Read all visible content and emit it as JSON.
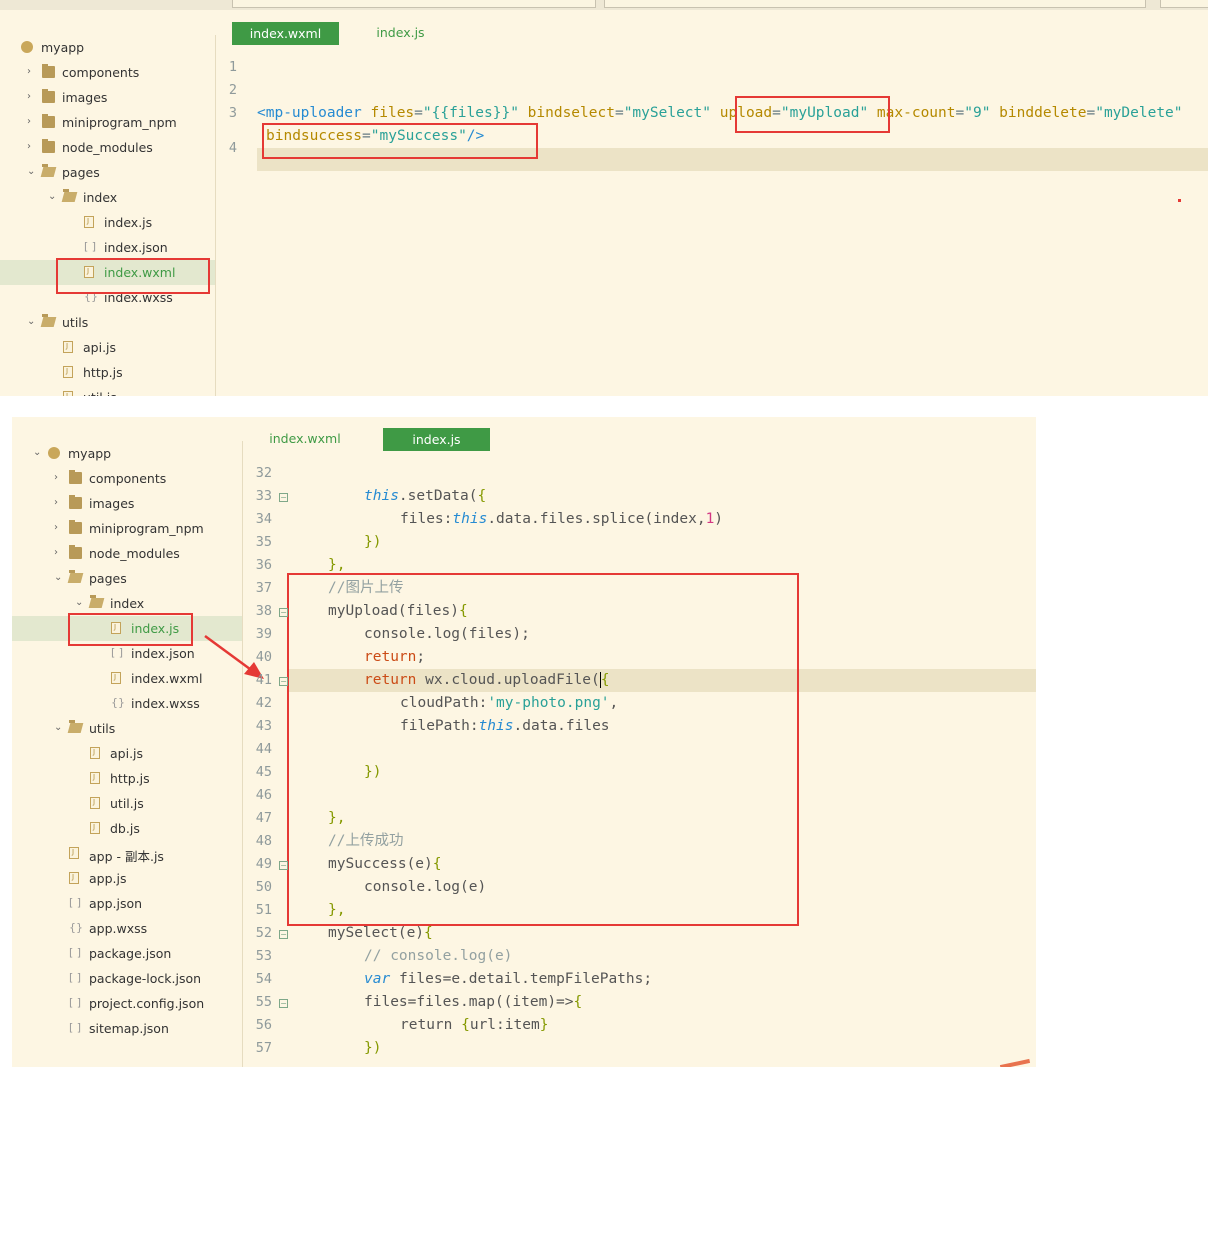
{
  "top": {
    "tree": {
      "items": [
        {
          "label": "myapp",
          "icon": "app-icon",
          "depth": 0,
          "chevron": ""
        },
        {
          "label": "components",
          "icon": "folder-icon",
          "depth": 1,
          "chevron": "›"
        },
        {
          "label": "images",
          "icon": "folder-icon",
          "depth": 1,
          "chevron": "›"
        },
        {
          "label": "miniprogram_npm",
          "icon": "folder-icon",
          "depth": 1,
          "chevron": "›"
        },
        {
          "label": "node_modules",
          "icon": "folder-icon",
          "depth": 1,
          "chevron": "›"
        },
        {
          "label": "pages",
          "icon": "folder-open-icon",
          "depth": 1,
          "chevron": "⌄"
        },
        {
          "label": "index",
          "icon": "folder-open-icon",
          "depth": 2,
          "chevron": "⌄"
        },
        {
          "label": "index.js",
          "icon": "js-file-icon",
          "depth": 3,
          "chevron": ""
        },
        {
          "label": "index.json",
          "icon": "json-file-icon",
          "depth": 3,
          "chevron": ""
        },
        {
          "label": "index.wxml",
          "icon": "wxml-file-icon",
          "depth": 3,
          "chevron": "",
          "selected": true
        },
        {
          "label": "index.wxss",
          "icon": "wxss-file-icon",
          "depth": 3,
          "chevron": ""
        },
        {
          "label": "utils",
          "icon": "folder-open-icon",
          "depth": 1,
          "chevron": "⌄"
        },
        {
          "label": "api.js",
          "icon": "js-file-icon",
          "depth": 2,
          "chevron": ""
        },
        {
          "label": "http.js",
          "icon": "js-file-icon",
          "depth": 2,
          "chevron": ""
        },
        {
          "label": "util.js",
          "icon": "js-file-icon",
          "depth": 2,
          "chevron": ""
        }
      ]
    },
    "tabs": [
      {
        "label": "index.wxml",
        "active": true
      },
      {
        "label": "index.js",
        "active": false
      }
    ],
    "line_numbers": [
      "1",
      "2",
      "3",
      "",
      "4"
    ]
  },
  "bottom": {
    "tree": {
      "items": [
        {
          "label": "myapp",
          "icon": "app-icon",
          "depth": 0,
          "chevron": "⌄"
        },
        {
          "label": "components",
          "icon": "folder-icon",
          "depth": 1,
          "chevron": "›"
        },
        {
          "label": "images",
          "icon": "folder-icon",
          "depth": 1,
          "chevron": "›"
        },
        {
          "label": "miniprogram_npm",
          "icon": "folder-icon",
          "depth": 1,
          "chevron": "›"
        },
        {
          "label": "node_modules",
          "icon": "folder-icon",
          "depth": 1,
          "chevron": "›"
        },
        {
          "label": "pages",
          "icon": "folder-open-icon",
          "depth": 1,
          "chevron": "⌄"
        },
        {
          "label": "index",
          "icon": "folder-open-icon",
          "depth": 2,
          "chevron": "⌄"
        },
        {
          "label": "index.js",
          "icon": "js-file-icon",
          "depth": 3,
          "chevron": "",
          "selected": true
        },
        {
          "label": "index.json",
          "icon": "json-file-icon",
          "depth": 3,
          "chevron": ""
        },
        {
          "label": "index.wxml",
          "icon": "wxml-file-icon",
          "depth": 3,
          "chevron": ""
        },
        {
          "label": "index.wxss",
          "icon": "wxss-file-icon",
          "depth": 3,
          "chevron": ""
        },
        {
          "label": "utils",
          "icon": "folder-open-icon",
          "depth": 1,
          "chevron": "⌄"
        },
        {
          "label": "api.js",
          "icon": "js-file-icon",
          "depth": 2,
          "chevron": ""
        },
        {
          "label": "http.js",
          "icon": "js-file-icon",
          "depth": 2,
          "chevron": ""
        },
        {
          "label": "util.js",
          "icon": "js-file-icon",
          "depth": 2,
          "chevron": ""
        },
        {
          "label": "db.js",
          "icon": "js-file-icon",
          "depth": 2,
          "chevron": ""
        },
        {
          "label": "app - 副本.js",
          "icon": "js-file-icon",
          "depth": 1,
          "chevron": ""
        },
        {
          "label": "app.js",
          "icon": "js-file-icon",
          "depth": 1,
          "chevron": ""
        },
        {
          "label": "app.json",
          "icon": "json-file-icon",
          "depth": 1,
          "chevron": ""
        },
        {
          "label": "app.wxss",
          "icon": "wxss-file-icon",
          "depth": 1,
          "chevron": ""
        },
        {
          "label": "package.json",
          "icon": "json-file-icon",
          "depth": 1,
          "chevron": ""
        },
        {
          "label": "package-lock.json",
          "icon": "json-file-icon",
          "depth": 1,
          "chevron": ""
        },
        {
          "label": "project.config.json",
          "icon": "json-file-icon",
          "depth": 1,
          "chevron": ""
        },
        {
          "label": "sitemap.json",
          "icon": "json-file-icon",
          "depth": 1,
          "chevron": ""
        }
      ]
    },
    "tabs": [
      {
        "label": "index.wxml",
        "active": false
      },
      {
        "label": "index.js",
        "active": true
      }
    ],
    "line_numbers": [
      "32",
      "33",
      "34",
      "35",
      "36",
      "37",
      "38",
      "39",
      "40",
      "41",
      "42",
      "43",
      "44",
      "45",
      "46",
      "47",
      "48",
      "49",
      "50",
      "51",
      "52",
      "53",
      "54",
      "55",
      "56",
      "57"
    ],
    "fold_lines": [
      "33",
      "38",
      "41",
      "49",
      "52",
      "55"
    ]
  },
  "colors": {
    "editor_bg": "#fdf6e3",
    "tab_active": "#3f9a45",
    "highlight_box": "#e53935"
  }
}
